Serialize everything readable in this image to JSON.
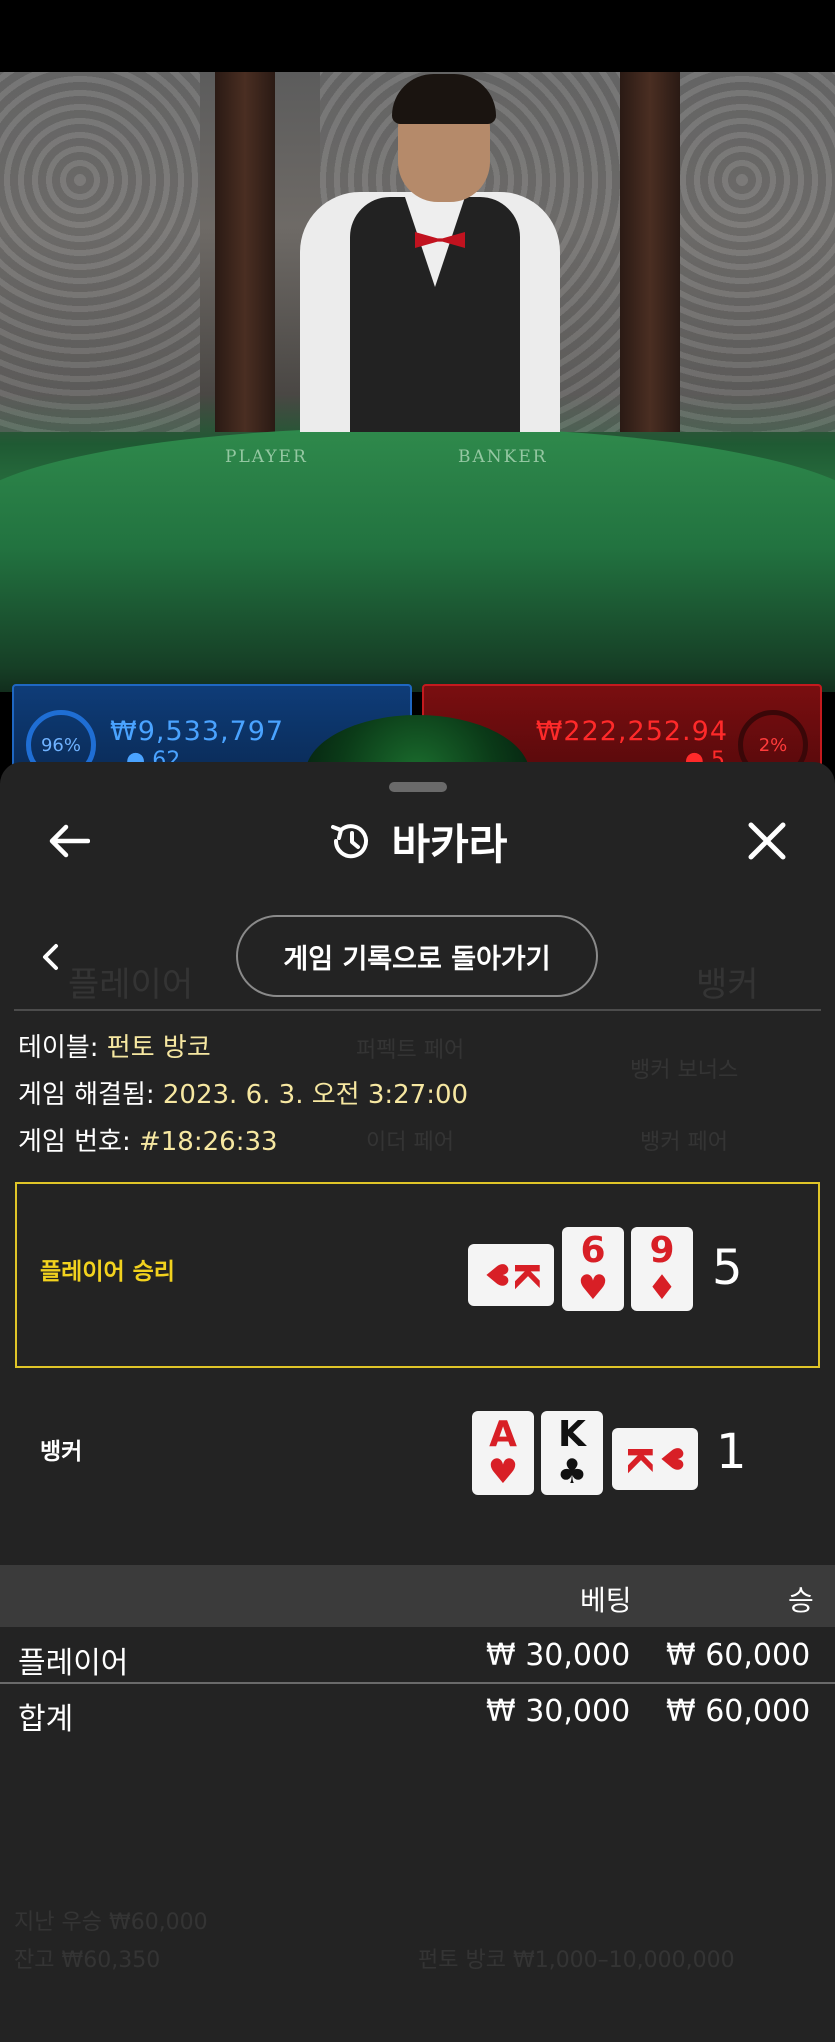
{
  "video": {
    "felt_player": "PLAYER",
    "felt_banker": "BANKER",
    "player_bar": {
      "percent": "96%",
      "amount": "₩9,533,797",
      "count": "62"
    },
    "banker_bar": {
      "percent": "2%",
      "amount": "₩222,252.94",
      "count": "5"
    }
  },
  "background_ghost": {
    "player": "플레이어",
    "banker": "뱅커",
    "perfect_pair": "퍼펙트 페어",
    "banker_bonus": "뱅커 보너스",
    "either_pair": "이더 페어",
    "banker_pair": "뱅커 페어",
    "last_win": "지난 우승 ₩60,000",
    "balance": "잔고 ₩60,350",
    "table_limit": "펀토 방코 ₩1,000–10,000,000"
  },
  "header": {
    "title": "바카라",
    "back_icon": "arrow-left-icon",
    "history_icon": "history-icon",
    "close_icon": "close-icon"
  },
  "nav": {
    "back_to_history_label": "게임 기록으로 돌아가기",
    "prev_icon": "chevron-left-icon"
  },
  "info": {
    "table_label": "테이블:",
    "table_value": "펀토 방코",
    "resolved_label": "게임 해결됨:",
    "resolved_value": "2023. 6. 3. 오전 3:27:00",
    "game_no_label": "게임 번호:",
    "game_no_value": "#18:26:33"
  },
  "results": {
    "player": {
      "label": "플레이어 승리",
      "score": "5",
      "cards": [
        {
          "rank": "K",
          "suit": "♥",
          "color": "red",
          "orientation": "side"
        },
        {
          "rank": "6",
          "suit": "♥",
          "color": "red",
          "orientation": "up"
        },
        {
          "rank": "9",
          "suit": "♦",
          "color": "red",
          "orientation": "up"
        }
      ]
    },
    "banker": {
      "label": "뱅커",
      "score": "1",
      "cards": [
        {
          "rank": "A",
          "suit": "♥",
          "color": "red",
          "orientation": "up"
        },
        {
          "rank": "K",
          "suit": "♣",
          "color": "black",
          "orientation": "up"
        },
        {
          "rank": "K",
          "suit": "♥",
          "color": "red",
          "orientation": "side"
        }
      ]
    }
  },
  "bets": {
    "col_bet": "베팅",
    "col_win": "승",
    "rows": [
      {
        "name": "플레이어",
        "bet": "₩ 30,000",
        "win": "₩ 60,000"
      }
    ],
    "total": {
      "name": "합계",
      "bet": "₩ 30,000",
      "win": "₩ 60,000"
    }
  }
}
